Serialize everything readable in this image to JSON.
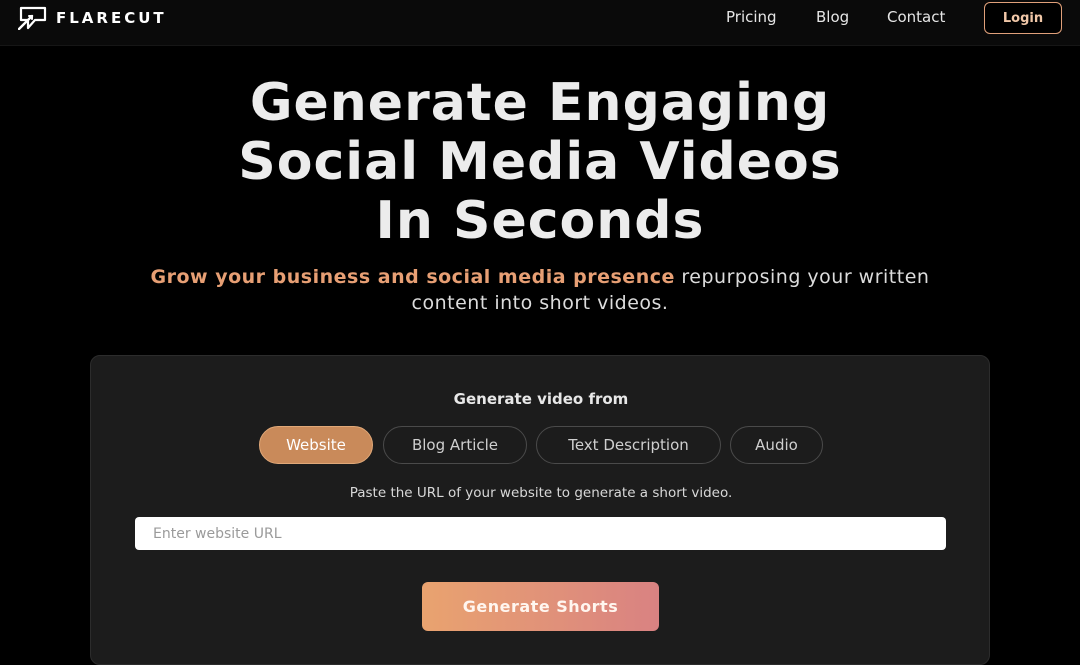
{
  "header": {
    "brand": "FLARECUT",
    "nav": [
      {
        "label": "Pricing"
      },
      {
        "label": "Blog"
      },
      {
        "label": "Contact"
      }
    ],
    "login_label": "Login"
  },
  "hero": {
    "title_lines": [
      "Generate Engaging",
      "Social Media Videos",
      "In Seconds"
    ],
    "subtitle_accent": "Grow your business and social media presence",
    "subtitle_rest": " repurposing your written content into short videos."
  },
  "generator": {
    "heading": "Generate video from",
    "tabs": [
      {
        "label": "Website",
        "active": true
      },
      {
        "label": "Blog Article",
        "active": false
      },
      {
        "label": "Text Description",
        "active": false
      },
      {
        "label": "Audio",
        "active": false
      }
    ],
    "helper_text": "Paste the URL of your website to generate a short video.",
    "input_placeholder": "Enter website URL",
    "input_value": "",
    "submit_label": "Generate Shorts"
  },
  "colors": {
    "accent": "#e79f74",
    "active_tab": "#c98a5a",
    "button_gradient_start": "#e9a36f",
    "button_gradient_end": "#d98282",
    "background": "#000000",
    "card": "#1c1c1c"
  },
  "icons": {
    "logo": "flarecut-logo-icon"
  }
}
